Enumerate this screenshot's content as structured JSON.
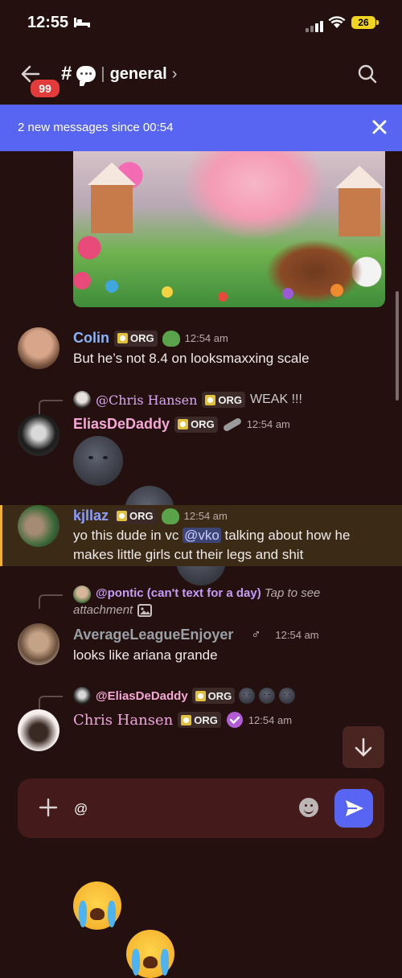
{
  "status_bar": {
    "time": "12:55",
    "battery": "26"
  },
  "header": {
    "badge_count": "99",
    "hash": "#",
    "separator": "|",
    "channel_name": "general",
    "chevron": "›"
  },
  "new_messages_bar": {
    "text": "2 new messages since 00:54"
  },
  "messages": [
    {
      "username": "Colin",
      "username_color": "#8ab4f8",
      "tag": "ORG",
      "timestamp": "12:54 am",
      "text": "But he’s not 8.4 on looksmaxxing scale"
    },
    {
      "reply_to": "@Chris Hansen",
      "reply_tag": "ORG",
      "reply_text": "WEAK !!!",
      "username": "EliasDeDaddy",
      "username_color": "#f6a8d6",
      "tag": "ORG",
      "timestamp": "12:54 am"
    },
    {
      "username": "kjllaz",
      "username_color": "#8b9dff",
      "tag": "ORG",
      "timestamp": "12:54 am",
      "text_before": "yo this dude in vc ",
      "mention": "@vko",
      "text_after": " talking about how he",
      "text_line2": "makes little girls cut their legs and shit"
    },
    {
      "reply_to": "@pontic (can't text for a day)",
      "reply_hint": "Tap to see",
      "reply_hint2": "attachment",
      "username": "AverageLeagueEnjoyer",
      "username_color": "#9aa0a6",
      "gender_symbol": "♂",
      "timestamp": "12:54 am",
      "text": "looks like ariana grande"
    },
    {
      "reply_to": "@EliasDeDaddy",
      "reply_tag": "ORG",
      "username": "Chris Hansen",
      "username_color": "#f2a6e0",
      "tag": "ORG",
      "timestamp": "12:54 am"
    }
  ],
  "input": {
    "value": "@"
  },
  "colors": {
    "accent": "#5865f2",
    "background": "#24100f",
    "highlight": "#f0b232"
  }
}
